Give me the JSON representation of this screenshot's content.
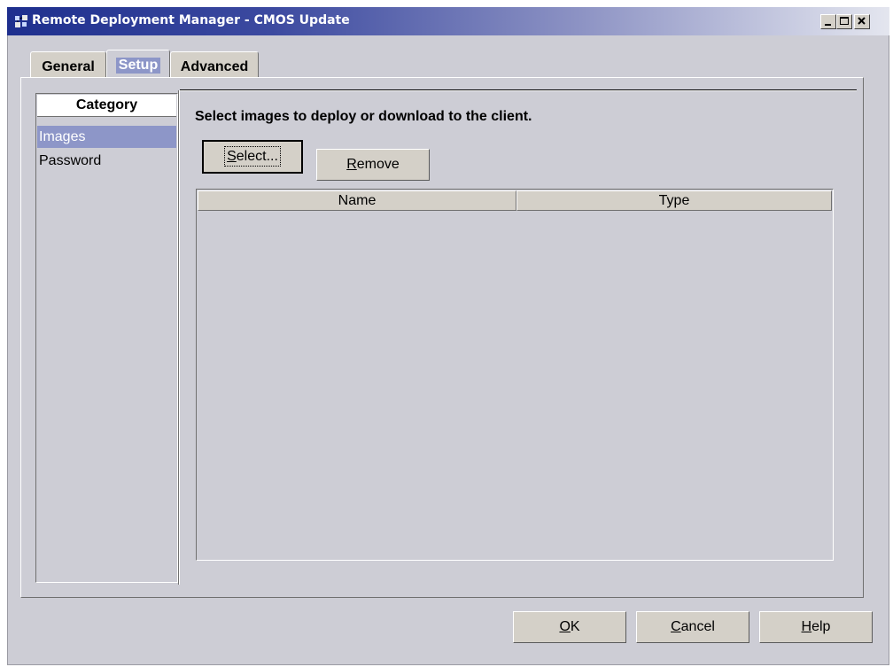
{
  "window": {
    "title": "Remote Deployment Manager - CMOS Update",
    "controls": [
      {
        "name": "minimize",
        "icon": "minimize-icon"
      },
      {
        "name": "maximize",
        "icon": "maximize-icon"
      },
      {
        "name": "close",
        "icon": "close-icon"
      }
    ],
    "app_icon": "rdm-app-icon"
  },
  "tabs": [
    {
      "label": "General",
      "active": false
    },
    {
      "label": "Setup",
      "active": true
    },
    {
      "label": "Advanced",
      "active": false
    }
  ],
  "sidebar": {
    "header": "Category",
    "items": [
      {
        "label": "Images",
        "selected": true
      },
      {
        "label": "Password",
        "selected": false
      }
    ]
  },
  "main": {
    "instruction": "Select images to deploy or download to the client.",
    "select_button": {
      "pre": "",
      "mnemonic": "S",
      "post": "elect..."
    },
    "remove_button": {
      "pre": "",
      "mnemonic": "R",
      "post": "emove"
    },
    "table": {
      "columns": [
        "Name",
        "Type"
      ],
      "rows": []
    }
  },
  "footer": {
    "ok": {
      "pre": "",
      "mnemonic": "O",
      "post": "K"
    },
    "cancel": {
      "pre": "",
      "mnemonic": "C",
      "post": "ancel"
    },
    "help": {
      "pre": "",
      "mnemonic": "H",
      "post": "elp"
    }
  },
  "colors": {
    "titlebar_start": "#1e2f8e",
    "titlebar_end": "#e4e6ef",
    "selection": "#8d96c8",
    "panel_bg": "#cdcdd5"
  }
}
